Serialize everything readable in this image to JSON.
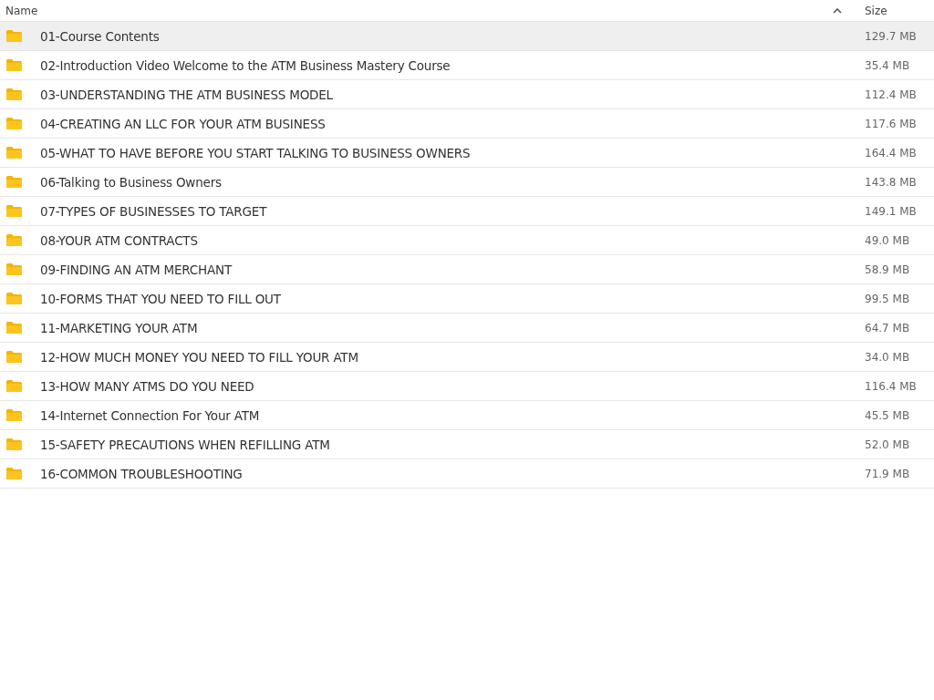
{
  "table": {
    "columns": [
      {
        "label": "Name",
        "sorted": true
      },
      {
        "label": "Size",
        "sorted": false
      }
    ],
    "rows": [
      {
        "name": "01-Course Contents",
        "size": "129.7 MB",
        "selected": true
      },
      {
        "name": "02-Introduction Video Welcome to the ATM Business Mastery Course",
        "size": "35.4 MB",
        "selected": false
      },
      {
        "name": "03-UNDERSTANDING THE ATM BUSINESS MODEL",
        "size": "112.4 MB",
        "selected": false
      },
      {
        "name": "04-CREATING AN LLC FOR YOUR ATM BUSINESS",
        "size": "117.6 MB",
        "selected": false
      },
      {
        "name": "05-WHAT TO HAVE BEFORE YOU START TALKING TO BUSINESS OWNERS",
        "size": "164.4 MB",
        "selected": false
      },
      {
        "name": "06-Talking to Business Owners",
        "size": "143.8 MB",
        "selected": false
      },
      {
        "name": "07-TYPES OF BUSINESSES TO TARGET",
        "size": "149.1 MB",
        "selected": false
      },
      {
        "name": "08-YOUR ATM CONTRACTS",
        "size": "49.0 MB",
        "selected": false
      },
      {
        "name": "09-FINDING AN ATM MERCHANT",
        "size": "58.9 MB",
        "selected": false
      },
      {
        "name": "10-FORMS THAT YOU NEED TO FILL OUT",
        "size": "99.5 MB",
        "selected": false
      },
      {
        "name": "11-MARKETING YOUR ATM",
        "size": "64.7 MB",
        "selected": false
      },
      {
        "name": "12-HOW MUCH MONEY YOU NEED TO FILL YOUR ATM",
        "size": "34.0 MB",
        "selected": false
      },
      {
        "name": "13-HOW MANY ATMS DO YOU NEED",
        "size": "116.4 MB",
        "selected": false
      },
      {
        "name": "14-Internet Connection For Your ATM",
        "size": "45.5 MB",
        "selected": false
      },
      {
        "name": "15-SAFETY PRECAUTIONS WHEN REFILLING ATM",
        "size": "52.0 MB",
        "selected": false
      },
      {
        "name": "16-COMMON TROUBLESHOOTING",
        "size": "71.9 MB",
        "selected": false
      }
    ]
  }
}
